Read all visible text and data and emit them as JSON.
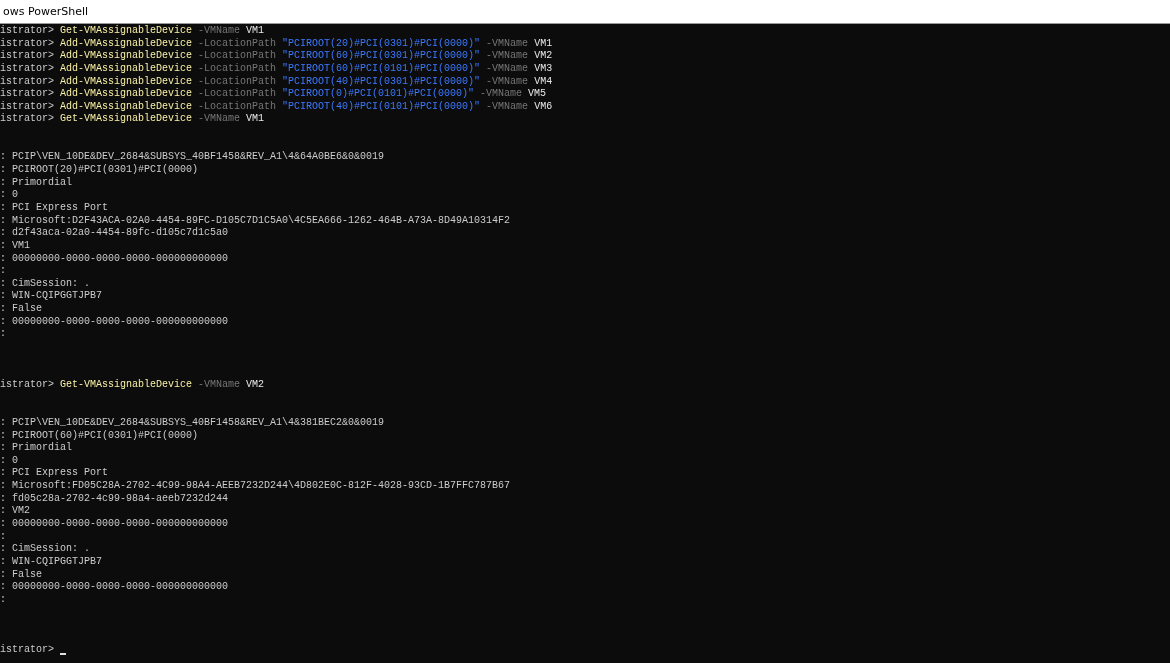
{
  "window": {
    "title": "ows PowerShell"
  },
  "lines": [
    {
      "kind": "command",
      "segments": [
        {
          "kind": "prompt",
          "text": "istrator>"
        },
        {
          "kind": "cmdlet",
          "text": "Get-VMAssignableDevice"
        },
        {
          "kind": "param",
          "text": "-VMName"
        },
        {
          "kind": "value",
          "text": "VM1"
        }
      ]
    },
    {
      "kind": "command",
      "segments": [
        {
          "kind": "prompt",
          "text": "istrator>"
        },
        {
          "kind": "cmdlet",
          "text": "Add-VMAssignableDevice"
        },
        {
          "kind": "param",
          "text": "-LocationPath"
        },
        {
          "kind": "string",
          "text": "\"PCIROOT(20)#PCI(0301)#PCI(0000)\""
        },
        {
          "kind": "param",
          "text": "-VMName"
        },
        {
          "kind": "value",
          "text": "VM1"
        }
      ]
    },
    {
      "kind": "command",
      "segments": [
        {
          "kind": "prompt",
          "text": "istrator>"
        },
        {
          "kind": "cmdlet",
          "text": "Add-VMAssignableDevice"
        },
        {
          "kind": "param",
          "text": "-LocationPath"
        },
        {
          "kind": "string",
          "text": "\"PCIROOT(60)#PCI(0301)#PCI(0000)\""
        },
        {
          "kind": "param",
          "text": "-VMName"
        },
        {
          "kind": "value",
          "text": "VM2"
        }
      ]
    },
    {
      "kind": "command",
      "segments": [
        {
          "kind": "prompt",
          "text": "istrator>"
        },
        {
          "kind": "cmdlet",
          "text": "Add-VMAssignableDevice"
        },
        {
          "kind": "param",
          "text": "-LocationPath"
        },
        {
          "kind": "string",
          "text": "\"PCIROOT(60)#PCI(0101)#PCI(0000)\""
        },
        {
          "kind": "param",
          "text": "-VMName"
        },
        {
          "kind": "value",
          "text": "VM3"
        }
      ]
    },
    {
      "kind": "command",
      "segments": [
        {
          "kind": "prompt",
          "text": "istrator>"
        },
        {
          "kind": "cmdlet",
          "text": "Add-VMAssignableDevice"
        },
        {
          "kind": "param",
          "text": "-LocationPath"
        },
        {
          "kind": "string",
          "text": "\"PCIROOT(40)#PCI(0301)#PCI(0000)\""
        },
        {
          "kind": "param",
          "text": "-VMName"
        },
        {
          "kind": "value",
          "text": "VM4"
        }
      ]
    },
    {
      "kind": "command",
      "segments": [
        {
          "kind": "prompt",
          "text": "istrator>"
        },
        {
          "kind": "cmdlet",
          "text": "Add-VMAssignableDevice"
        },
        {
          "kind": "param",
          "text": "-LocationPath"
        },
        {
          "kind": "string",
          "text": "\"PCIROOT(0)#PCI(0101)#PCI(0000)\""
        },
        {
          "kind": "param",
          "text": "-VMName"
        },
        {
          "kind": "value",
          "text": "VM5"
        }
      ]
    },
    {
      "kind": "command",
      "segments": [
        {
          "kind": "prompt",
          "text": "istrator>"
        },
        {
          "kind": "cmdlet",
          "text": "Add-VMAssignableDevice"
        },
        {
          "kind": "param",
          "text": "-LocationPath"
        },
        {
          "kind": "string",
          "text": "\"PCIROOT(40)#PCI(0101)#PCI(0000)\""
        },
        {
          "kind": "param",
          "text": "-VMName"
        },
        {
          "kind": "value",
          "text": "VM6"
        }
      ]
    },
    {
      "kind": "command",
      "segments": [
        {
          "kind": "prompt",
          "text": "istrator>"
        },
        {
          "kind": "cmdlet",
          "text": "Get-VMAssignableDevice"
        },
        {
          "kind": "param",
          "text": "-VMName"
        },
        {
          "kind": "value",
          "text": "VM1"
        }
      ]
    },
    {
      "kind": "blank"
    },
    {
      "kind": "blank"
    },
    {
      "kind": "output",
      "text": ": PCIP\\VEN_10DE&DEV_2684&SUBSYS_40BF1458&REV_A1\\4&64A0BE6&0&0019"
    },
    {
      "kind": "output",
      "text": ": PCIROOT(20)#PCI(0301)#PCI(0000)"
    },
    {
      "kind": "output",
      "text": ": Primordial"
    },
    {
      "kind": "output",
      "text": ": 0"
    },
    {
      "kind": "output",
      "text": ": PCI Express Port"
    },
    {
      "kind": "output",
      "text": ": Microsoft:D2F43ACA-02A0-4454-89FC-D105C7D1C5A0\\4C5EA666-1262-464B-A73A-8D49A10314F2"
    },
    {
      "kind": "output",
      "text": ": d2f43aca-02a0-4454-89fc-d105c7d1c5a0"
    },
    {
      "kind": "output",
      "text": ": VM1"
    },
    {
      "kind": "output",
      "text": ": 00000000-0000-0000-0000-000000000000"
    },
    {
      "kind": "output",
      "text": ":"
    },
    {
      "kind": "output",
      "text": ": CimSession: ."
    },
    {
      "kind": "output",
      "text": ": WIN-CQIPGGTJPB7"
    },
    {
      "kind": "output",
      "text": ": False"
    },
    {
      "kind": "output",
      "text": ": 00000000-0000-0000-0000-000000000000"
    },
    {
      "kind": "output",
      "text": ":"
    },
    {
      "kind": "blank"
    },
    {
      "kind": "blank"
    },
    {
      "kind": "blank"
    },
    {
      "kind": "command",
      "segments": [
        {
          "kind": "prompt",
          "text": "istrator>"
        },
        {
          "kind": "cmdlet",
          "text": "Get-VMAssignableDevice"
        },
        {
          "kind": "param",
          "text": "-VMName"
        },
        {
          "kind": "value",
          "text": "VM2"
        }
      ]
    },
    {
      "kind": "blank"
    },
    {
      "kind": "blank"
    },
    {
      "kind": "output",
      "text": ": PCIP\\VEN_10DE&DEV_2684&SUBSYS_40BF1458&REV_A1\\4&381BEC2&0&0019"
    },
    {
      "kind": "output",
      "text": ": PCIROOT(60)#PCI(0301)#PCI(0000)"
    },
    {
      "kind": "output",
      "text": ": Primordial"
    },
    {
      "kind": "output",
      "text": ": 0"
    },
    {
      "kind": "output",
      "text": ": PCI Express Port"
    },
    {
      "kind": "output",
      "text": ": Microsoft:FD05C28A-2702-4C99-98A4-AEEB7232D244\\4D802E0C-812F-4028-93CD-1B7FFC787B67"
    },
    {
      "kind": "output",
      "text": ": fd05c28a-2702-4c99-98a4-aeeb7232d244"
    },
    {
      "kind": "output",
      "text": ": VM2"
    },
    {
      "kind": "output",
      "text": ": 00000000-0000-0000-0000-000000000000"
    },
    {
      "kind": "output",
      "text": ":"
    },
    {
      "kind": "output",
      "text": ": CimSession: ."
    },
    {
      "kind": "output",
      "text": ": WIN-CQIPGGTJPB7"
    },
    {
      "kind": "output",
      "text": ": False"
    },
    {
      "kind": "output",
      "text": ": 00000000-0000-0000-0000-000000000000"
    },
    {
      "kind": "output",
      "text": ":"
    },
    {
      "kind": "blank"
    },
    {
      "kind": "blank"
    },
    {
      "kind": "blank"
    },
    {
      "kind": "command",
      "cursor": true,
      "segments": [
        {
          "kind": "prompt",
          "text": "istrator>"
        }
      ]
    }
  ]
}
